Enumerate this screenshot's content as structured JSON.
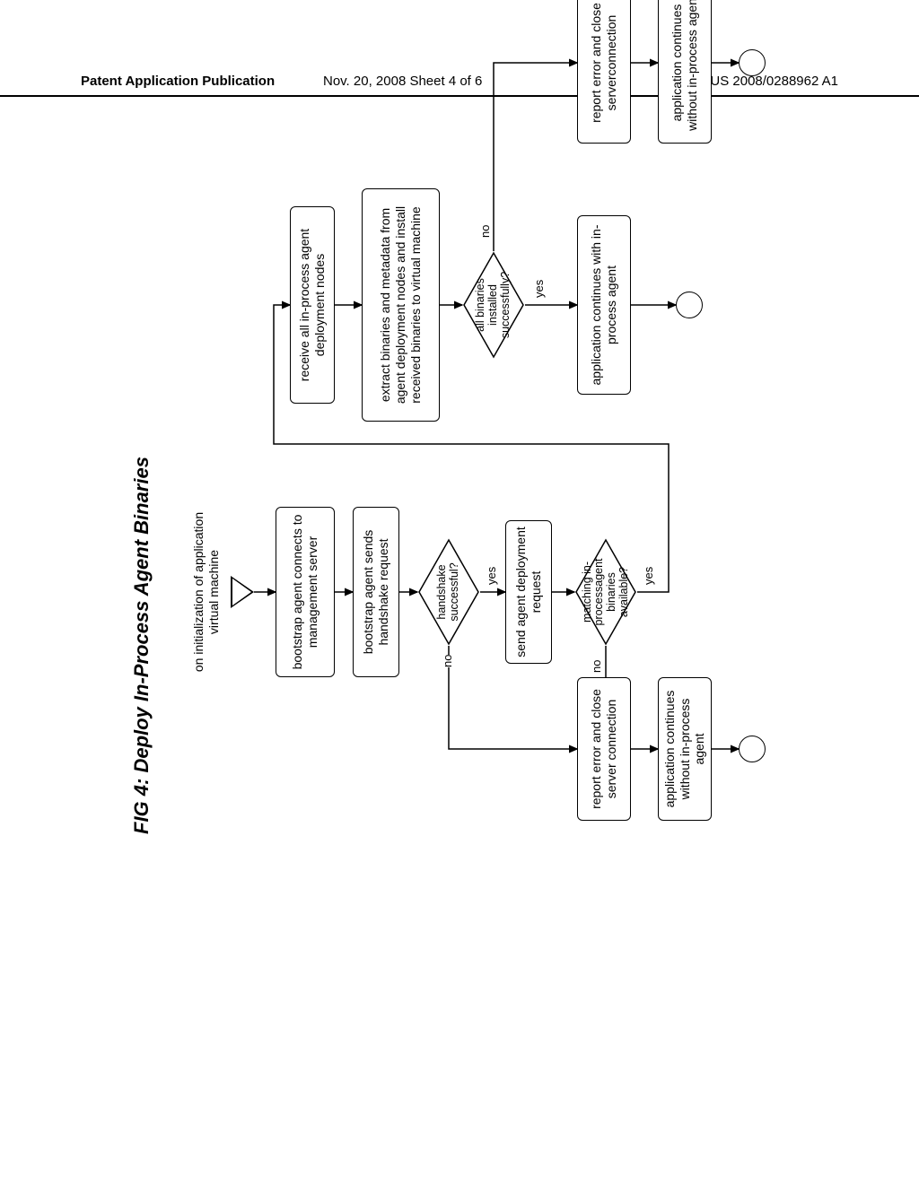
{
  "header": {
    "left": "Patent Application Publication",
    "middle": "Nov. 20, 2008  Sheet 4 of 6",
    "right": "US 2008/0288962 A1"
  },
  "figure": {
    "title": "FIG 4: Deploy In-Process Agent Binaries",
    "start_event": "on initialization of application virtual machine",
    "steps": {
      "connect": "bootstrap agent connects to management server",
      "handshake": "bootstrap agent sends handshake request",
      "send_deploy": "send agent deployment request",
      "receive_nodes": "receive all in-process agent deployment nodes",
      "extract_install": "extract binaries and metadata from agent deployment nodes and install received binaries to virtual machine",
      "report_close_left": "report error and close server connection",
      "cont_without_left": "application continues without in-process agent",
      "report_close_right": "report error and close serverconnection",
      "cont_without_right": "application continues without in-process agent",
      "cont_with": "application continues with in-process agent"
    },
    "decisions": {
      "handshake_ok": "handshake successful?",
      "binaries_avail": "matching in-processagent binaries available?",
      "all_installed": "all binaries installed successfully?"
    },
    "labels": {
      "yes": "yes",
      "no": "no"
    }
  }
}
